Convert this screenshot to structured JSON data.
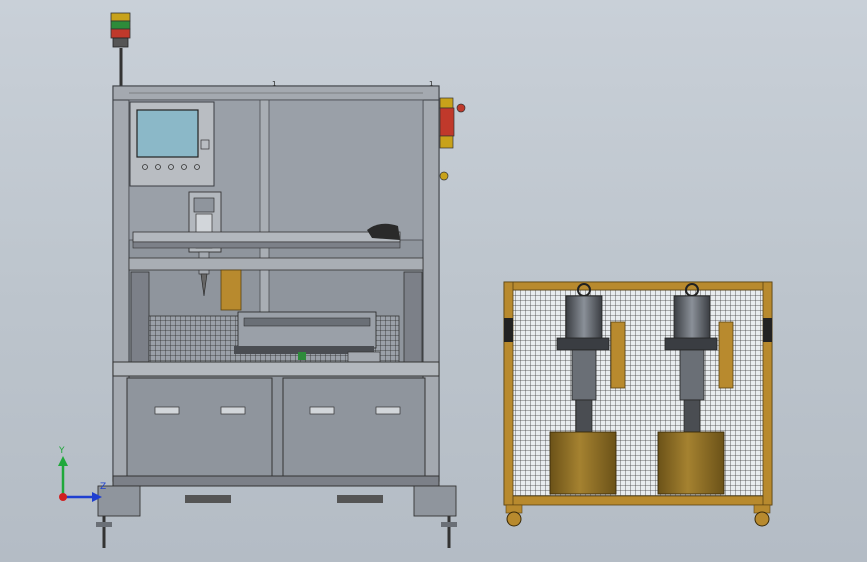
{
  "view": {
    "callouts": [
      "1",
      "1"
    ],
    "axes": {
      "y": "Y",
      "x": "",
      "z": "Z"
    }
  },
  "colors": {
    "background": "#c0c8d0",
    "frame": "#7c8088",
    "panel": "#8f959d",
    "screen": "#8bb8c8",
    "wood": "#b88a2e",
    "tank": "#8a6a24",
    "mesh": "#3c3c3c",
    "beacon_red": "#c0392b",
    "beacon_green": "#2e8b3a",
    "beacon_amber": "#c8a21a"
  },
  "components": {
    "main_machine": "dispensing-station",
    "supply_cart": "material-supply-cart",
    "tower_light": "status-tower-light",
    "hmi": "hmi-touchscreen",
    "hmi_buttons": 5,
    "drawer_handles": 4,
    "pumps": 2
  }
}
